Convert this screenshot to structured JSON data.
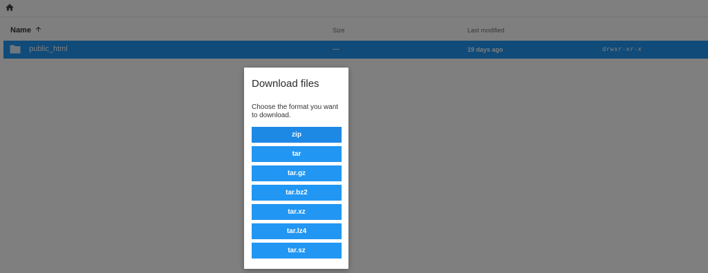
{
  "breadcrumb": {
    "home_icon": "home-icon"
  },
  "listing": {
    "columns": {
      "name": "Name",
      "size": "Size",
      "modified": "Last modified"
    },
    "rows": [
      {
        "icon": "folder-icon",
        "name": "public_html",
        "size": "—",
        "modified": "19 days ago",
        "permissions": "drwxr-xr-x"
      }
    ]
  },
  "dialog": {
    "title": "Download files",
    "message": "Choose the format you want to download.",
    "formats": [
      "zip",
      "tar",
      "tar.gz",
      "tar.bz2",
      "tar.xz",
      "tar.lz4",
      "tar.sz"
    ]
  },
  "colors": {
    "accent": "#2196f3",
    "overlay": "rgba(0,0,0,0.5)"
  }
}
